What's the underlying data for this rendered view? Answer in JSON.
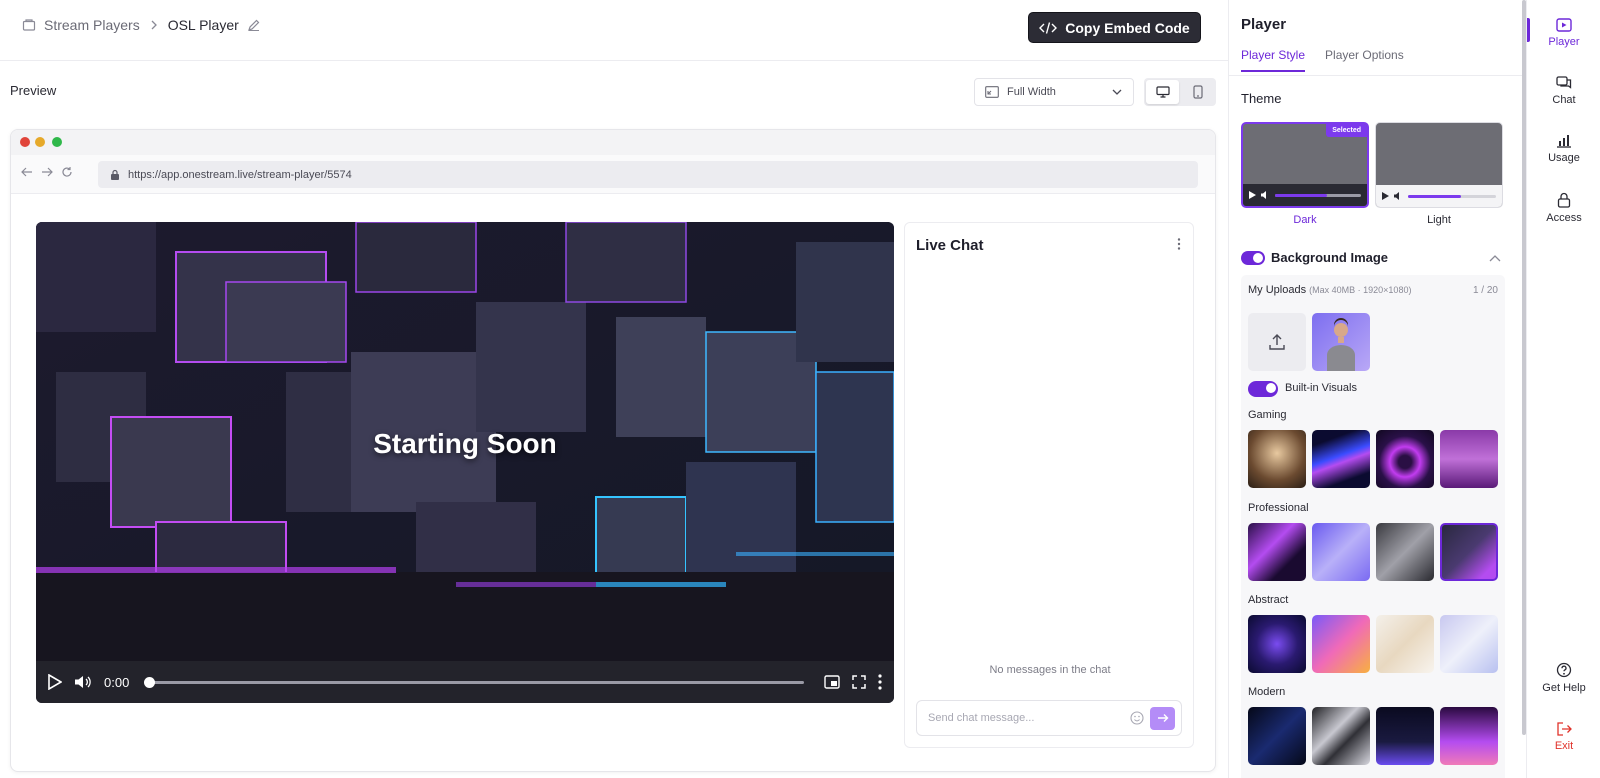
{
  "breadcrumb": {
    "parent": "Stream Players",
    "current": "OSL Player"
  },
  "toolbar": {
    "embed_label": "Copy Embed Code"
  },
  "preview": {
    "label": "Preview",
    "width_option": "Full Width"
  },
  "browser": {
    "url": "https://app.onestream.live/stream-player/5574"
  },
  "video": {
    "title": "Starting Soon",
    "time": "0:00",
    "progress": 0
  },
  "chat": {
    "title": "Live Chat",
    "empty_text": "No messages in the chat",
    "placeholder": "Send chat message..."
  },
  "panel": {
    "title": "Player",
    "tabs": [
      "Player Style",
      "Player Options"
    ],
    "active_tab": "Player Style",
    "theme_label": "Theme",
    "themes": [
      {
        "name": "Dark",
        "selected": true,
        "badge": "Selected"
      },
      {
        "name": "Light",
        "selected": false
      }
    ],
    "background_image": {
      "label": "Background Image",
      "enabled": true
    },
    "uploads": {
      "label": "My Uploads",
      "hint": "(Max 40MB · 1920×1080)",
      "count": "1 / 20"
    },
    "builtin": {
      "label": "Built-in Visuals",
      "enabled": true
    },
    "categories": [
      "Gaming",
      "Professional",
      "Abstract",
      "Modern"
    ]
  },
  "rail": {
    "items": [
      "Player",
      "Chat",
      "Usage",
      "Access"
    ],
    "help": "Get Help",
    "exit": "Exit"
  },
  "colors": {
    "accent": "#6d28d9",
    "dark_button": "#2c2c35",
    "exit": "#e0322a"
  }
}
